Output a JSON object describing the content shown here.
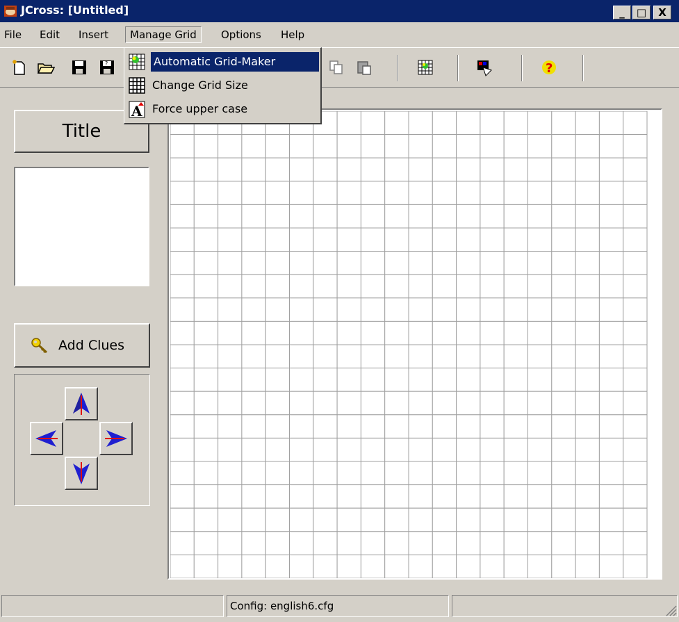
{
  "window": {
    "title": "JCross: [Untitled]",
    "controls": {
      "minimize": "_",
      "maximize": "□",
      "close": "X"
    }
  },
  "menubar": {
    "items": [
      {
        "label": "File"
      },
      {
        "label": "Edit"
      },
      {
        "label": "Insert"
      },
      {
        "label": "Manage Grid",
        "open": true
      },
      {
        "label": "Options"
      },
      {
        "label": "Help"
      }
    ]
  },
  "manage_grid_menu": {
    "items": [
      {
        "label": "Automatic Grid-Maker",
        "icon": "grid-maker-icon",
        "highlighted": true
      },
      {
        "label": "Change Grid Size",
        "icon": "grid-size-icon"
      },
      {
        "label": "Force upper case",
        "icon": "upper-case-icon"
      }
    ]
  },
  "toolbar": {
    "icons": [
      "new-file-icon",
      "open-folder-icon",
      "save-icon",
      "save-as-icon",
      "copy-icon",
      "paste-icon",
      "grid-maker-icon",
      "export-icon",
      "help-icon"
    ]
  },
  "left_panel": {
    "title_button": "Title",
    "title_text": "",
    "add_clues_label": "Add Clues",
    "directions": [
      "up",
      "left",
      "right",
      "down"
    ]
  },
  "grid": {
    "cols": 20,
    "rows": 20,
    "selected_cell": [
      0,
      0
    ]
  },
  "statusbar": {
    "panel1": "",
    "panel2": "Config: english6.cfg",
    "panel3": ""
  },
  "colors": {
    "titlebar": "#0a246a",
    "highlight": "#0a246a",
    "face": "#d4d0c8",
    "arrow_red": "#c0504d",
    "dir_blue": "#1f1fd0",
    "dir_red": "#e01010"
  }
}
